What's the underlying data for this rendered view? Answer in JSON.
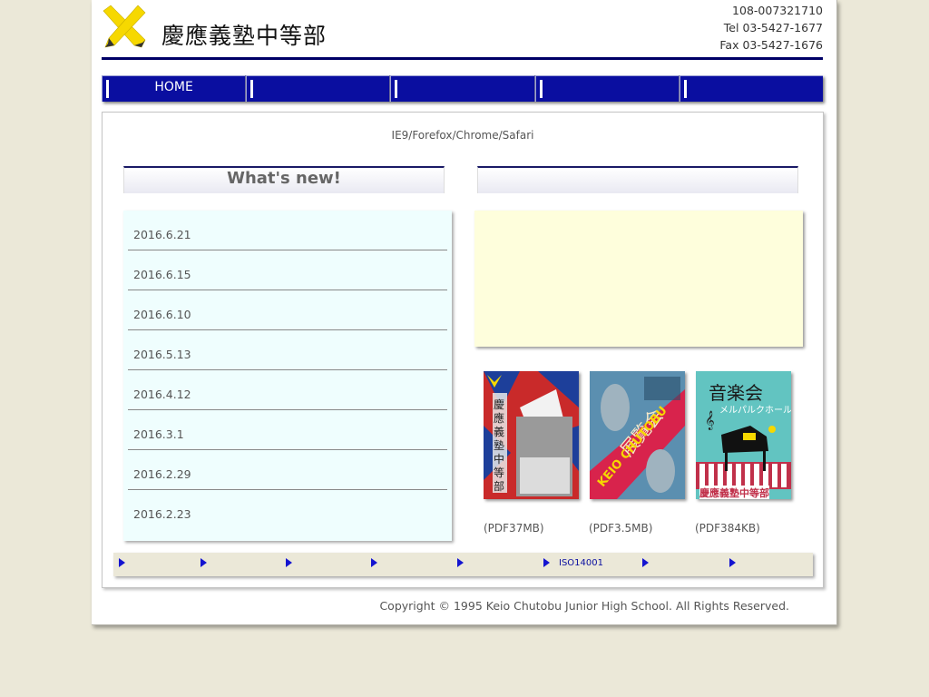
{
  "header": {
    "school_name": "慶應義塾中等部",
    "contact_line1": "108-007321710",
    "contact_line2": "Tel 03-5427-1677",
    "contact_line3": "Fax 03-5427-1676"
  },
  "nav": {
    "items": [
      {
        "label": "HOME"
      },
      {
        "label": ""
      },
      {
        "label": ""
      },
      {
        "label": ""
      },
      {
        "label": ""
      }
    ]
  },
  "main": {
    "browser_note": "IE9/Forefox/Chrome/Safari",
    "whats_new_title": "What's new!",
    "right_section_title": "",
    "news": [
      {
        "date": "2016.6.21"
      },
      {
        "date": "2016.6.15"
      },
      {
        "date": "2016.6.10"
      },
      {
        "date": "2016.5.13"
      },
      {
        "date": "2016.4.12"
      },
      {
        "date": "2016.3.1"
      },
      {
        "date": "2016.2.29"
      },
      {
        "date": "2016.2.23"
      }
    ],
    "posters": [
      {
        "caption": "(PDF37MB)",
        "text": "慶應義塾中等部"
      },
      {
        "caption": "(PDF3.5MB)",
        "text": "展覧会",
        "subtext": "KEIO CHUTOBU"
      },
      {
        "caption": "(PDF384KB)",
        "text": "音楽会",
        "subtext": "メルパルクホール",
        "footer": "慶應義塾中等部"
      }
    ]
  },
  "bottom_links": [
    {
      "label": ""
    },
    {
      "label": ""
    },
    {
      "label": ""
    },
    {
      "label": ""
    },
    {
      "label": ""
    },
    {
      "label": "ISO14001"
    },
    {
      "label": ""
    },
    {
      "label": ""
    }
  ],
  "footer": {
    "copyright": "Copyright © 1995 Keio Chutobu Junior High School. All Rights Reserved."
  },
  "colors": {
    "background": "#ebe8d8",
    "nav_blue": "#0a0ea0",
    "header_rule": "#000066",
    "news_bg": "#effefe",
    "notice_bg": "#fefedc",
    "logo_yellow": "#f6d800"
  }
}
